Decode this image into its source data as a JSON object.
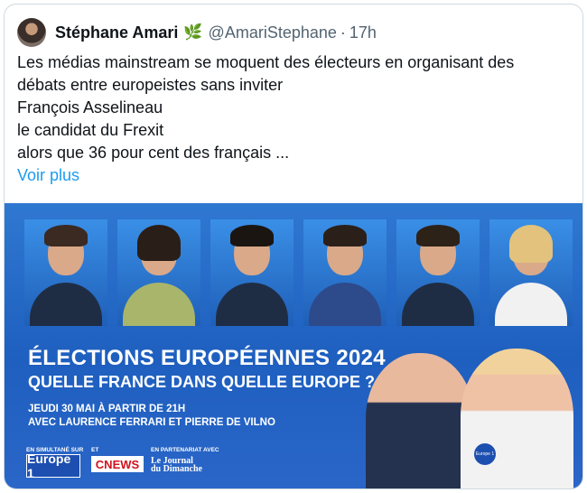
{
  "tweet": {
    "author_name": "Stéphane Amari",
    "badge_emoji": "🌿",
    "handle": "@AmariStephane",
    "separator": "·",
    "time": "17h",
    "text_lines": [
      "Les médias mainstream se moquent des électeurs en organisant des",
      "débats entre europeistes sans inviter",
      "François Asselineau",
      "le candidat du Frexit",
      "alors que 36 pour cent des français ..."
    ],
    "show_more": "Voir plus"
  },
  "media": {
    "title_line1": "ÉLECTIONS EUROPÉENNES 2024",
    "title_line2": "QUELLE FRANCE DANS QUELLE EUROPE ?",
    "subtitle_line1": "JEUDI 30 MAI À PARTIR DE 21H",
    "subtitle_line2": "AVEC LAURENCE FERRARI ET PIERRE DE VILNO",
    "caption_simulcast": "EN SIMULTANÉ SUR",
    "caption_and": "ET",
    "caption_partner": "EN PARTENARIAT AVEC",
    "logo_europe1": "Europe 1",
    "logo_cnews": "CNEWS",
    "logo_jdd_line1": "Le Journal",
    "logo_jdd_line2": "du Dimanche",
    "mic_label": "Europe 1"
  }
}
